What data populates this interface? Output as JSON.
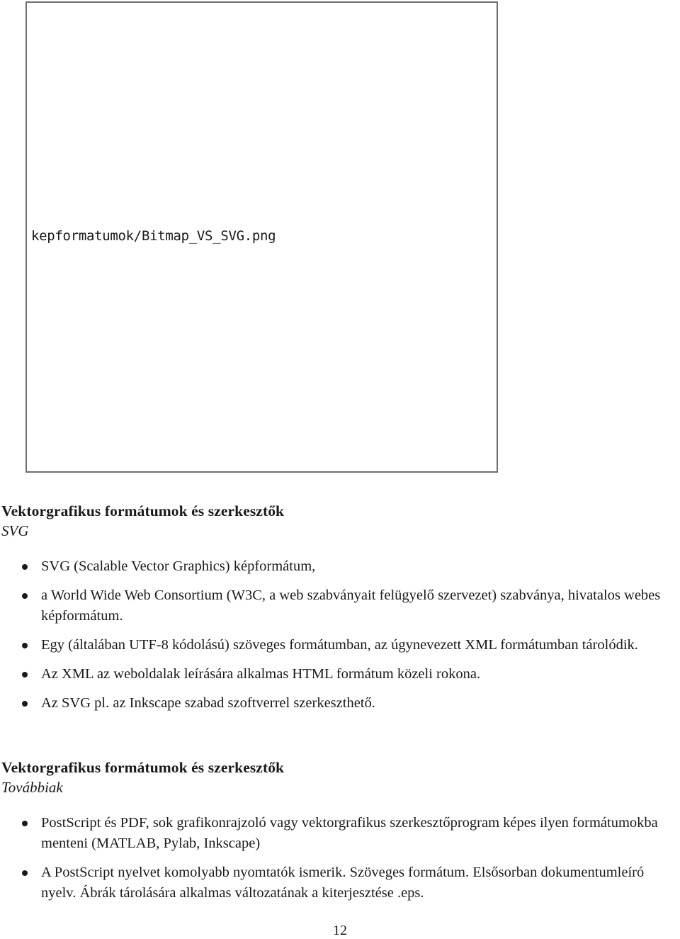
{
  "figure": {
    "placeholder_path": "kepformatumok/Bitmap_VS_SVG.png"
  },
  "sections": [
    {
      "title": "Vektorgrafikus formátumok és szerkesztők",
      "subtitle": "SVG",
      "items": [
        "SVG (Scalable Vector Graphics) képformátum,",
        "a World Wide Web Consortium (W3C, a web szabványait felügyelő szervezet) szabványa, hivatalos webes képformátum.",
        "Egy (általában UTF-8 kódolású) szöveges formátumban, az úgynevezett XML formátumban tárolódik.",
        "Az XML az weboldalak leírására alkalmas HTML formátum közeli rokona.",
        "Az SVG pl. az Inkscape szabad szoftverrel szerkeszthető."
      ]
    },
    {
      "title": "Vektorgrafikus formátumok és szerkesztők",
      "subtitle": "Továbbiak",
      "items": [
        "PostScript és PDF, sok grafikonrajzoló vagy vektorgrafikus szerkesztőprogram képes ilyen formátumokba menteni (MATLAB, Pylab, Inkscape)",
        "A PostScript nyelvet komolyabb nyomtatók ismerik. Szöveges formátum. Elsősorban dokumentumleíró nyelv. Ábrák tárolására alkalmas változatának a kiterjesztése .eps."
      ]
    }
  ],
  "page_number": "12"
}
